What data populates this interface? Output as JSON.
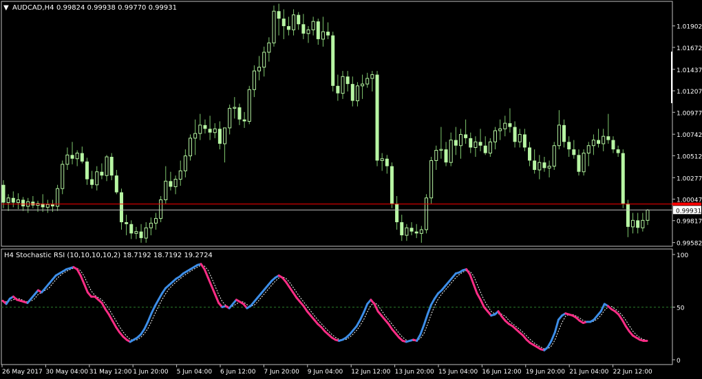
{
  "header": {
    "symbol": "AUDCAD,H4",
    "ohlc": "0.99824 0.99938 0.99770 0.99931",
    "menu_glyph": "▼"
  },
  "indicator": {
    "label": "H4 Stochastic RSI (10,10,10,10,2) 18.7192 18.7192 19.2724"
  },
  "colors": {
    "background": "#000000",
    "axis": "#c0c0c0",
    "candle": "#b7f5a3",
    "wick": "#7fc86e",
    "price_line": "#ff0000",
    "bid_line": "#c0c0c0",
    "stoch_up": "#3d8ee8",
    "stoch_down": "#ff2d86",
    "signal": "#ffffff",
    "level_50": "#2a7a2a"
  },
  "chart_data": [
    {
      "type": "candlestick",
      "title": "AUDCAD,H4",
      "ylim": [
        0.9955,
        1.0215
      ],
      "y_ticks": [
        "1.01902",
        "1.01672",
        "1.01437",
        "1.01207",
        "1.00977",
        "1.00742",
        "1.00512",
        "1.00277",
        "1.00047",
        "0.99817",
        "0.99582"
      ],
      "current_price_label": "0.99931",
      "horizontal_line_price": 0.99995,
      "bid_line_price": 0.99931,
      "candles_ohlc": [
        [
          1.002,
          1.0025,
          0.9995,
          1.0001
        ],
        [
          1.0001,
          1.001,
          0.9992,
          1.0006
        ],
        [
          1.0006,
          1.0013,
          0.9996,
          1.0001
        ],
        [
          1.0001,
          1.0011,
          0.9994,
          1.0004
        ],
        [
          1.0004,
          1.0007,
          0.9992,
          0.9997
        ],
        [
          0.9997,
          1.0006,
          0.999,
          1.0002
        ],
        [
          1.0002,
          1.0008,
          0.9995,
          0.9998
        ],
        [
          0.9998,
          1.0003,
          0.9991,
          1.0
        ],
        [
          1.0,
          1.001,
          0.9991,
          0.9996
        ],
        [
          0.9996,
          1.0004,
          0.999,
          0.9999
        ],
        [
          0.9999,
          1.0004,
          0.9991,
          0.9997
        ],
        [
          0.9997,
          1.002,
          0.9992,
          1.0016
        ],
        [
          1.0016,
          1.0046,
          1.001,
          1.0042
        ],
        [
          1.0042,
          1.006,
          1.0036,
          1.0052
        ],
        [
          1.0052,
          1.0066,
          1.0042,
          1.0048
        ],
        [
          1.0048,
          1.0057,
          1.004,
          1.0054
        ],
        [
          1.0054,
          1.0061,
          1.0043,
          1.0045
        ],
        [
          1.0045,
          1.0049,
          1.002,
          1.0026
        ],
        [
          1.0026,
          1.0035,
          1.0016,
          1.002
        ],
        [
          1.002,
          1.004,
          1.0014,
          1.0034
        ],
        [
          1.0034,
          1.0043,
          1.0026,
          1.003
        ],
        [
          1.003,
          1.0052,
          1.0024,
          1.005
        ],
        [
          1.005,
          1.0054,
          1.0025,
          1.003
        ],
        [
          1.003,
          1.0036,
          1.001,
          1.0012
        ],
        [
          1.0012,
          1.0016,
          0.9972,
          0.998
        ],
        [
          0.998,
          0.9988,
          0.9966,
          0.9978
        ],
        [
          0.9978,
          0.9982,
          0.9962,
          0.9968
        ],
        [
          0.9968,
          0.9975,
          0.9962,
          0.997
        ],
        [
          0.997,
          0.9978,
          0.9958,
          0.9963
        ],
        [
          0.9963,
          0.998,
          0.9958,
          0.9974
        ],
        [
          0.9974,
          0.9985,
          0.9966,
          0.9979
        ],
        [
          0.9979,
          0.999,
          0.9972,
          0.9984
        ],
        [
          0.9984,
          1.0008,
          0.998,
          1.0004
        ],
        [
          1.0004,
          1.004,
          1.0,
          1.0024
        ],
        [
          1.0024,
          1.0034,
          1.0014,
          1.0018
        ],
        [
          1.0018,
          1.003,
          1.001,
          1.0026
        ],
        [
          1.0026,
          1.0046,
          1.0019,
          1.0035
        ],
        [
          1.0035,
          1.0058,
          1.0028,
          1.0051
        ],
        [
          1.0051,
          1.0074,
          1.0046,
          1.007
        ],
        [
          1.007,
          1.009,
          1.0052,
          1.0075
        ],
        [
          1.0075,
          1.0096,
          1.0068,
          1.0084
        ],
        [
          1.0084,
          1.009,
          1.0075,
          1.008
        ],
        [
          1.008,
          1.0094,
          1.0068,
          1.0076
        ],
        [
          1.0076,
          1.0086,
          1.007,
          1.008
        ],
        [
          1.008,
          1.0088,
          1.0058,
          1.0064
        ],
        [
          1.0064,
          1.0075,
          1.0044,
          1.0081
        ],
        [
          1.0081,
          1.0106,
          1.0074,
          1.0102
        ],
        [
          1.0102,
          1.0114,
          1.0091,
          1.0103
        ],
        [
          1.0103,
          1.0107,
          1.0084,
          1.009
        ],
        [
          1.009,
          1.0098,
          1.0081,
          1.0088
        ],
        [
          1.0088,
          1.0126,
          1.0085,
          1.0122
        ],
        [
          1.0122,
          1.0148,
          1.0114,
          1.0142
        ],
        [
          1.0142,
          1.0158,
          1.0132,
          1.0146
        ],
        [
          1.0146,
          1.0168,
          1.0136,
          1.0162
        ],
        [
          1.0162,
          1.0178,
          1.0152,
          1.0172
        ],
        [
          1.0172,
          1.0212,
          1.0168,
          1.0206
        ],
        [
          1.0206,
          1.0214,
          1.018,
          1.0198
        ],
        [
          1.0198,
          1.0208,
          1.0176,
          1.019
        ],
        [
          1.019,
          1.02,
          1.018,
          1.0186
        ],
        [
          1.0186,
          1.0208,
          1.018,
          1.0202
        ],
        [
          1.0202,
          1.0205,
          1.0186,
          1.0192
        ],
        [
          1.0192,
          1.0203,
          1.0176,
          1.0182
        ],
        [
          1.0182,
          1.019,
          1.0172,
          1.0186
        ],
        [
          1.0186,
          1.02,
          1.018,
          1.0195
        ],
        [
          1.0195,
          1.0198,
          1.017,
          1.0176
        ],
        [
          1.0176,
          1.02,
          1.0168,
          1.0184
        ],
        [
          1.0184,
          1.0194,
          1.0176,
          1.018
        ],
        [
          1.018,
          1.0184,
          1.012,
          1.0126
        ],
        [
          1.0126,
          1.0138,
          1.011,
          1.0118
        ],
        [
          1.0118,
          1.0142,
          1.0112,
          1.0136
        ],
        [
          1.0136,
          1.0142,
          1.012,
          1.0128
        ],
        [
          1.0128,
          1.0136,
          1.0104,
          1.011
        ],
        [
          1.011,
          1.013,
          1.0104,
          1.0126
        ],
        [
          1.0126,
          1.0138,
          1.0112,
          1.0128
        ],
        [
          1.0128,
          1.014,
          1.0124,
          1.0134
        ],
        [
          1.0134,
          1.0142,
          1.012,
          1.0138
        ],
        [
          1.0138,
          1.0142,
          1.004,
          1.0046
        ],
        [
          1.0046,
          1.0054,
          1.0035,
          1.0048
        ],
        [
          1.0048,
          1.0052,
          1.0032,
          1.004
        ],
        [
          1.004,
          1.0044,
          0.9995,
          1.0
        ],
        [
          1.0,
          1.0008,
          0.9972,
          0.998
        ],
        [
          0.998,
          0.9988,
          0.996,
          0.9966
        ],
        [
          0.9966,
          0.9978,
          0.996,
          0.9974
        ],
        [
          0.9974,
          0.998,
          0.9966,
          0.997
        ],
        [
          0.997,
          0.9978,
          0.9963,
          0.9968
        ],
        [
          0.9968,
          0.9976,
          0.9958,
          0.9972
        ],
        [
          0.9972,
          1.001,
          0.9968,
          1.0006
        ],
        [
          1.0006,
          1.005,
          1.0,
          1.0046
        ],
        [
          1.0046,
          1.0062,
          1.0036,
          1.0057
        ],
        [
          1.0057,
          1.0082,
          1.0048,
          1.0058
        ],
        [
          1.0058,
          1.0066,
          1.004,
          1.0044
        ],
        [
          1.0044,
          1.0076,
          1.004,
          1.0068
        ],
        [
          1.0068,
          1.0082,
          1.0052,
          1.0062
        ],
        [
          1.0062,
          1.008,
          1.0048,
          1.0074
        ],
        [
          1.0074,
          1.009,
          1.0064,
          1.007
        ],
        [
          1.007,
          1.0076,
          1.0054,
          1.006
        ],
        [
          1.006,
          1.0072,
          1.005,
          1.0066
        ],
        [
          1.0066,
          1.008,
          1.0056,
          1.0062
        ],
        [
          1.0062,
          1.0072,
          1.0052,
          1.0054
        ],
        [
          1.0054,
          1.007,
          1.005,
          1.0066
        ],
        [
          1.0066,
          1.0082,
          1.0058,
          1.0078
        ],
        [
          1.0078,
          1.009,
          1.0068,
          1.008
        ],
        [
          1.008,
          1.0094,
          1.0072,
          1.0086
        ],
        [
          1.0086,
          1.0102,
          1.0076,
          1.0082
        ],
        [
          1.0082,
          1.0088,
          1.006,
          1.0066
        ],
        [
          1.0066,
          1.008,
          1.006,
          1.0074
        ],
        [
          1.0074,
          1.008,
          1.0056,
          1.006
        ],
        [
          1.006,
          1.0066,
          1.004,
          1.0046
        ],
        [
          1.0046,
          1.0058,
          1.0032,
          1.0036
        ],
        [
          1.0036,
          1.0052,
          1.0026,
          1.0044
        ],
        [
          1.0044,
          1.005,
          1.0034,
          1.0038
        ],
        [
          1.0038,
          1.0046,
          1.0028,
          1.004
        ],
        [
          1.004,
          1.0066,
          1.0036,
          1.0062
        ],
        [
          1.0062,
          1.01,
          1.0058,
          1.0084
        ],
        [
          1.0084,
          1.009,
          1.006,
          1.0066
        ],
        [
          1.0066,
          1.0072,
          1.005,
          1.0058
        ],
        [
          1.0058,
          1.0068,
          1.0048,
          1.0052
        ],
        [
          1.0052,
          1.0058,
          1.003,
          1.0034
        ],
        [
          1.0034,
          1.0058,
          1.003,
          1.0054
        ],
        [
          1.0054,
          1.0066,
          1.004,
          1.0062
        ],
        [
          1.0062,
          1.0074,
          1.0052,
          1.0068
        ],
        [
          1.0068,
          1.008,
          1.006,
          1.0064
        ],
        [
          1.0064,
          1.008,
          1.0056,
          1.0072
        ],
        [
          1.0072,
          1.0096,
          1.0064,
          1.0068
        ],
        [
          1.0068,
          1.0072,
          1.0054,
          1.0058
        ],
        [
          1.0058,
          1.0062,
          1.005,
          1.0054
        ],
        [
          1.0054,
          1.0058,
          0.9995,
          1.0
        ],
        [
          1.0,
          1.0004,
          0.9964,
          0.9975
        ],
        [
          0.9975,
          0.999,
          0.9968,
          0.9982
        ],
        [
          0.9982,
          0.999,
          0.9968,
          0.9974
        ],
        [
          0.9974,
          0.999,
          0.997,
          0.9982
        ],
        [
          0.9982,
          0.9994,
          0.9977,
          0.9993
        ]
      ]
    },
    {
      "type": "line",
      "title": "H4 Stochastic RSI (10,10,10,10,2) 18.7192 18.7192 19.2724",
      "ylim": [
        0,
        100
      ],
      "y_ticks": [
        "100",
        "50",
        "0"
      ],
      "level_line": 50,
      "series": [
        {
          "values": [
            56,
            53,
            58,
            60,
            57,
            56,
            55,
            54,
            58,
            62,
            66,
            64,
            68,
            72,
            76,
            80,
            82,
            84,
            86,
            87,
            88,
            86,
            80,
            72,
            64,
            60,
            60,
            57,
            54,
            48,
            43,
            37,
            31,
            26,
            22,
            19,
            17,
            19,
            21,
            24,
            29,
            36,
            44,
            51,
            57,
            63,
            68,
            71,
            74,
            77,
            79,
            82,
            84,
            86,
            88,
            90,
            91,
            86,
            78,
            70,
            62,
            54,
            50,
            51,
            49,
            53,
            57,
            55,
            53,
            49,
            51,
            55,
            59,
            63,
            67,
            71,
            75,
            78,
            80,
            78,
            74,
            69,
            64,
            59,
            55,
            51,
            46,
            42,
            38,
            34,
            31,
            27,
            24,
            21,
            19,
            18,
            19,
            21,
            24,
            28,
            32,
            38,
            45,
            53,
            57,
            53,
            46,
            42,
            38,
            34,
            29,
            25,
            21,
            18,
            17,
            18,
            19,
            18,
            24,
            33,
            43,
            52,
            58,
            63,
            66,
            70,
            74,
            78,
            82,
            83,
            85,
            86,
            81,
            72,
            63,
            57,
            50,
            46,
            42,
            43,
            46,
            41,
            37,
            34,
            32,
            29,
            26,
            23,
            19,
            16,
            14,
            12,
            10,
            9,
            12,
            18,
            26,
            38,
            42,
            44,
            43,
            42,
            40,
            37,
            35,
            36,
            36,
            38,
            42,
            46,
            53,
            51,
            48,
            46,
            43,
            38,
            32,
            27,
            23,
            21,
            19,
            18,
            18
          ],
          "direction": [
            1,
            -1,
            1,
            1,
            -1,
            -1,
            -1,
            -1,
            1,
            1,
            1,
            -1,
            1,
            1,
            1,
            1,
            1,
            1,
            1,
            1,
            1,
            -1,
            -1,
            -1,
            -1,
            -1,
            -1,
            -1,
            -1,
            -1,
            -1,
            -1,
            -1,
            -1,
            -1,
            -1,
            -1,
            1,
            1,
            1,
            1,
            1,
            1,
            1,
            1,
            1,
            1,
            1,
            1,
            1,
            1,
            1,
            1,
            1,
            1,
            1,
            1,
            -1,
            -1,
            -1,
            -1,
            -1,
            -1,
            1,
            -1,
            1,
            1,
            -1,
            -1,
            -1,
            1,
            1,
            1,
            1,
            1,
            1,
            1,
            1,
            1,
            -1,
            -1,
            -1,
            -1,
            -1,
            -1,
            -1,
            -1,
            -1,
            -1,
            -1,
            -1,
            -1,
            -1,
            -1,
            -1,
            -1,
            1,
            1,
            1,
            1,
            1,
            1,
            1,
            1,
            1,
            -1,
            -1,
            -1,
            -1,
            -1,
            -1,
            -1,
            -1,
            -1,
            -1,
            1,
            1,
            -1,
            1,
            1,
            1,
            1,
            1,
            1,
            1,
            1,
            1,
            1,
            1,
            1,
            1,
            1,
            -1,
            -1,
            -1,
            -1,
            -1,
            -1,
            -1,
            1,
            1,
            -1,
            -1,
            -1,
            -1,
            -1,
            -1,
            -1,
            -1,
            -1,
            -1,
            -1,
            -1,
            -1,
            1,
            1,
            1,
            1,
            1,
            1,
            -1,
            -1,
            -1,
            -1,
            -1,
            -1,
            1,
            1,
            1,
            1,
            1,
            1,
            -1,
            -1,
            -1,
            -1,
            -1,
            -1,
            -1,
            -1,
            -1,
            -1,
            -1,
            -1
          ]
        }
      ]
    }
  ],
  "time_axis": {
    "labels": [
      "26 May 2017",
      "30 May 04:00",
      "31 May 12:00",
      "1 Jun 20:00",
      "5 Jun 04:00",
      "6 Jun 12:00",
      "7 Jun 20:00",
      "9 Jun 04:00",
      "12 Jun 12:00",
      "13 Jun 20:00",
      "15 Jun 04:00",
      "16 Jun 12:00",
      "19 Jun 20:00",
      "21 Jun 04:00",
      "22 Jun 12:00"
    ]
  }
}
